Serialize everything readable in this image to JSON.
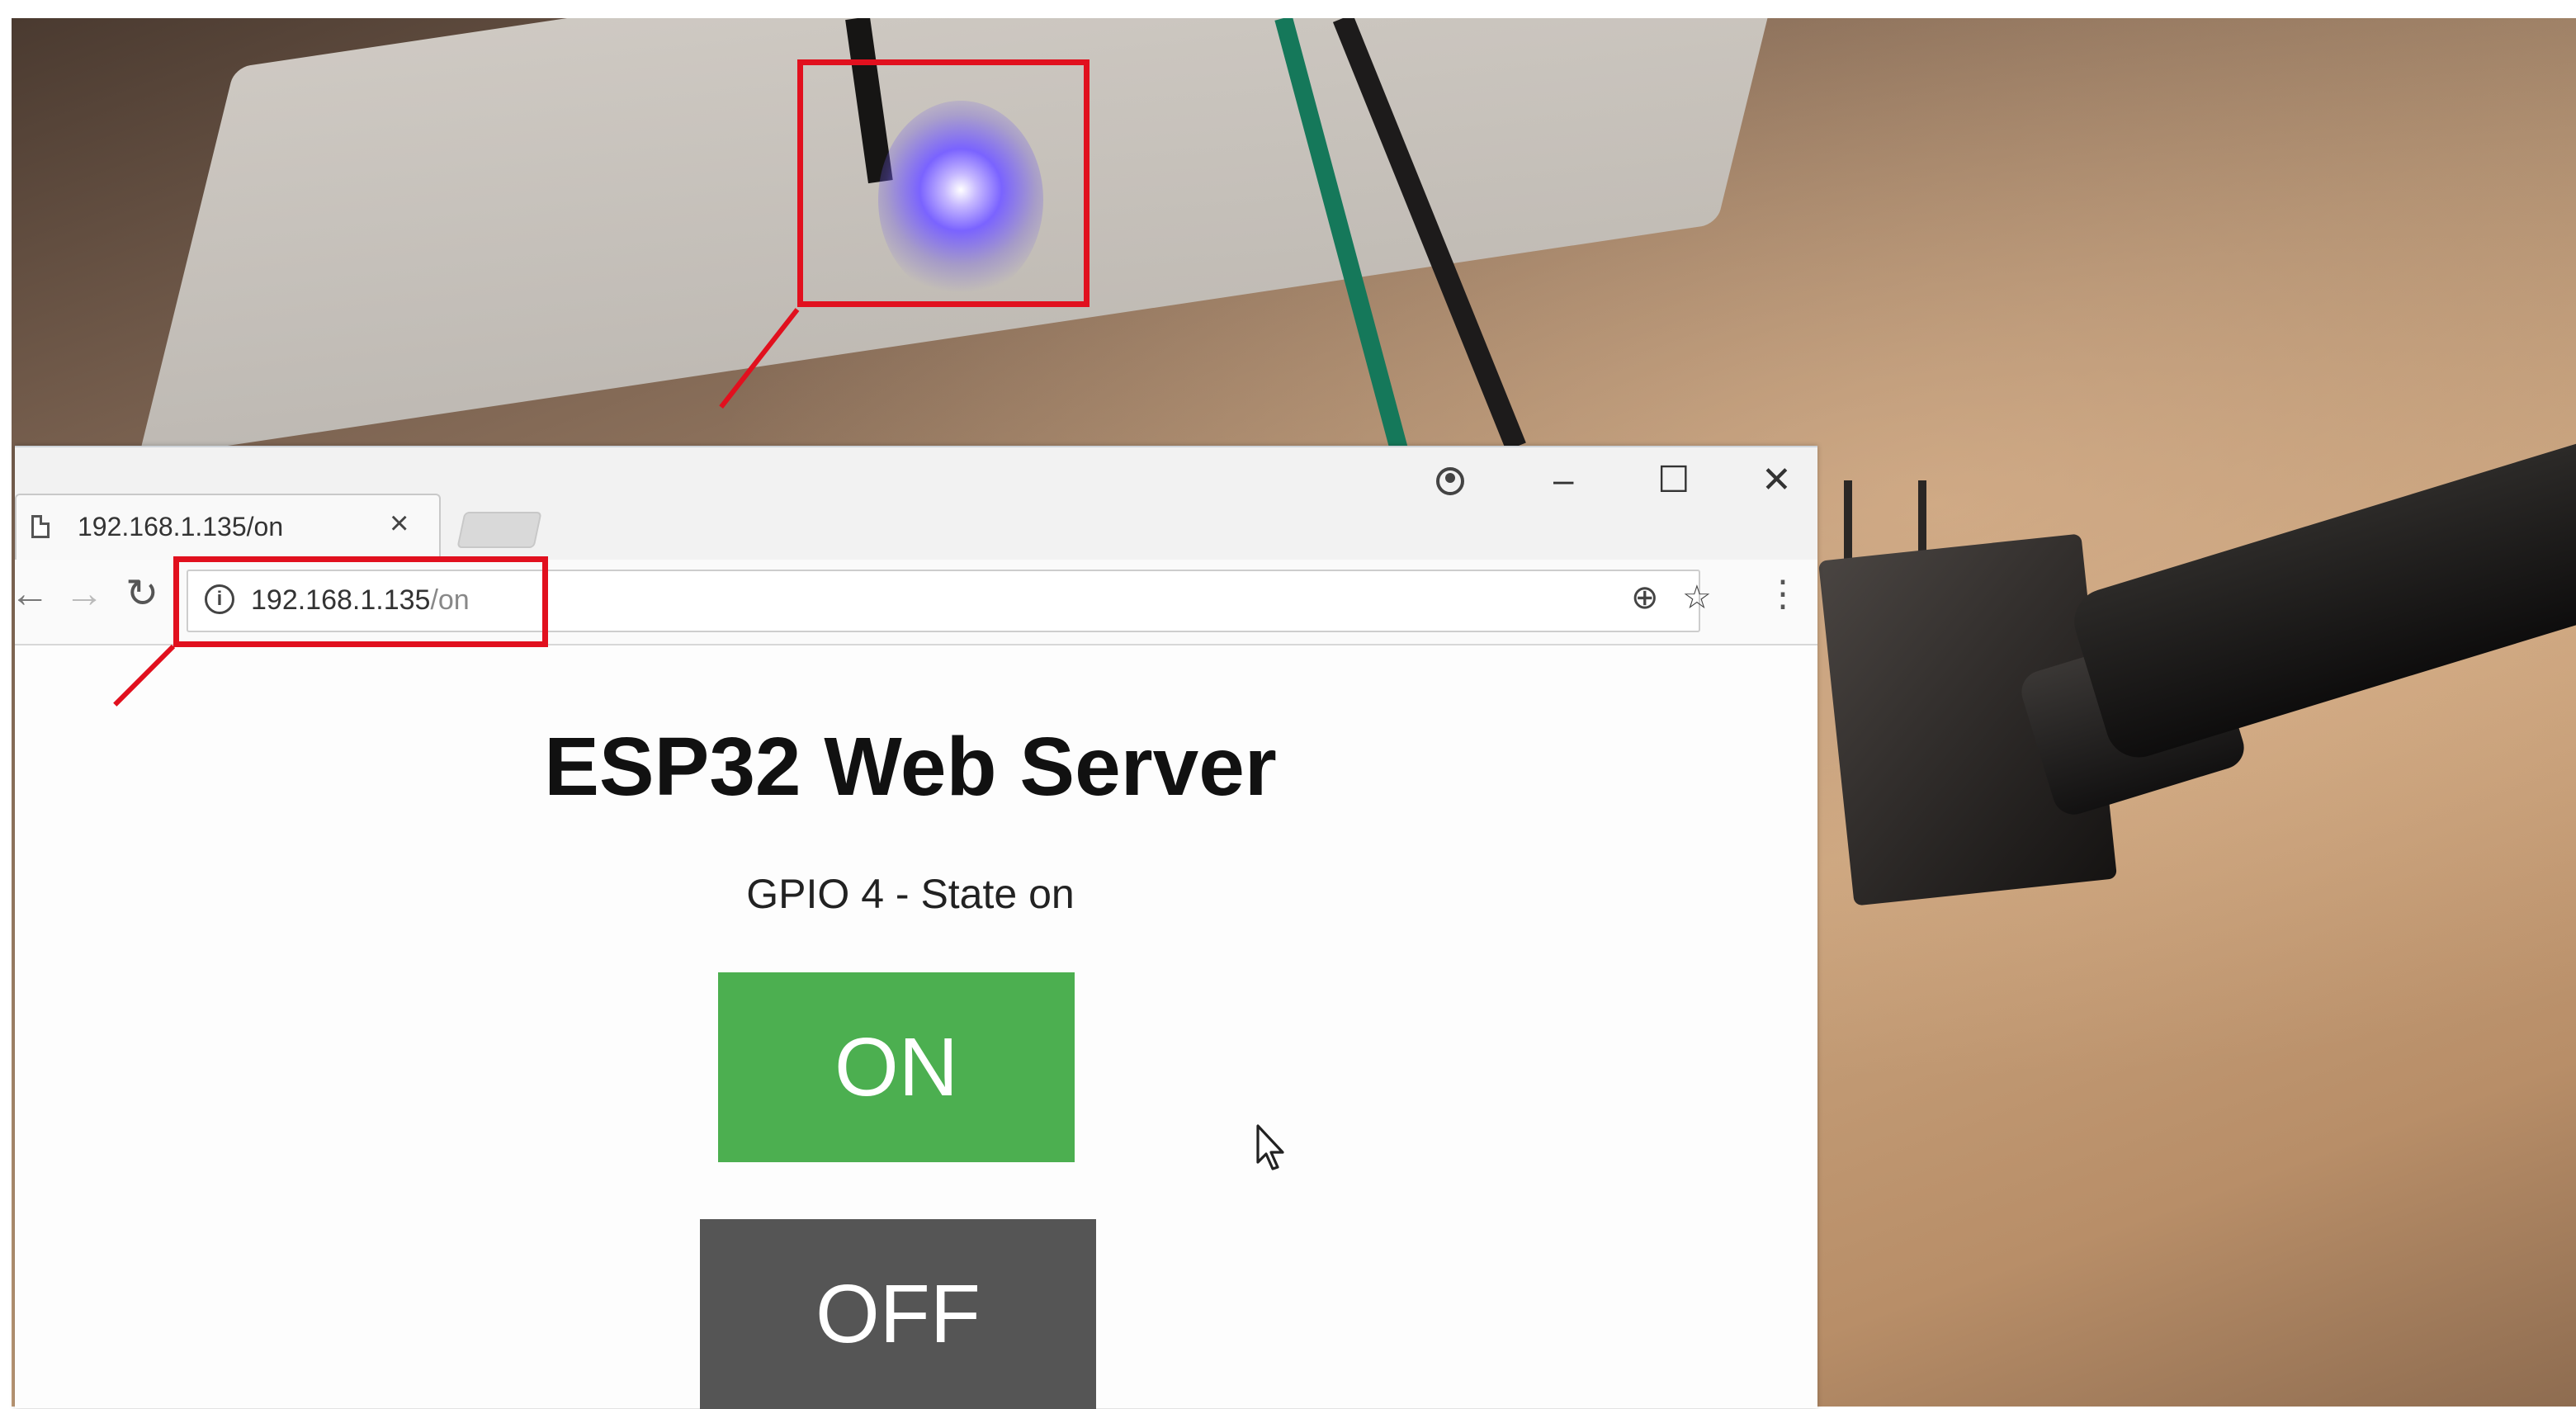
{
  "browser": {
    "tab": {
      "title": "192.168.1.135/on",
      "close_glyph": "×"
    },
    "window_controls": {
      "minimize": "–",
      "maximize": "☐",
      "close": "✕"
    },
    "address_bar": {
      "host": "192.168.1.135",
      "path": "/on"
    }
  },
  "page": {
    "title": "ESP32 Web Server",
    "state_text": "GPIO 4 - State on",
    "on_button_label": "ON",
    "off_button_label": "OFF"
  },
  "icons": {
    "document": "document-icon",
    "back": "back-arrow-icon",
    "forward": "forward-arrow-icon",
    "reload": "reload-icon",
    "info": "info-icon",
    "zoom": "zoom-icon",
    "bookmark": "star-icon",
    "menu": "kebab-menu-icon",
    "profile": "profile-icon",
    "cursor": "mouse-cursor-icon"
  },
  "colors": {
    "on_button": "#4caf50",
    "off_button": "#555555",
    "annotation": "#e1101e",
    "led_glow": "#7a63ff"
  }
}
